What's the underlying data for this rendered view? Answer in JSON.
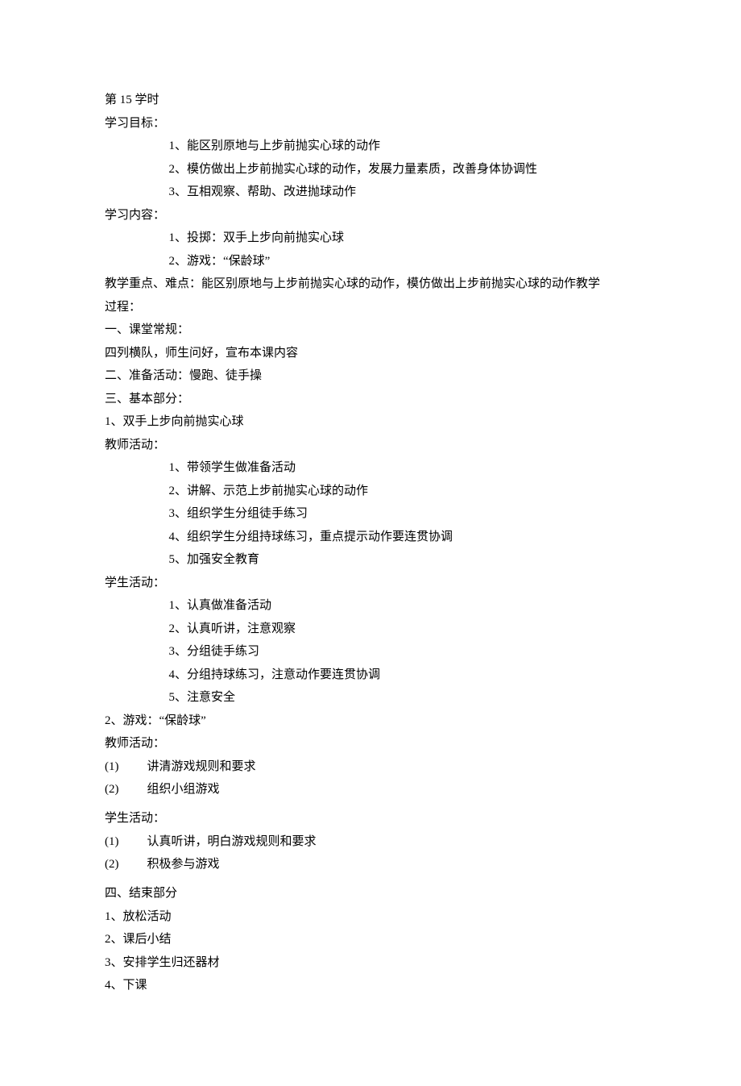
{
  "lesson_header": "第 15 学时",
  "labels": {
    "goals": "学习目标：",
    "content": "学习内容：",
    "keypoints_prefix": "教学重点、难点：",
    "process_suffix": "过程：",
    "section1": "一、课堂常规：",
    "section1_body": "四列横队，师生问好，宣布本课内容",
    "section2": "二、准备活动：慢跑、徒手操",
    "section3": "三、基本部分：",
    "part1": "1、双手上步向前抛实心球",
    "teacher_act": "教师活动：",
    "student_act": "学生活动：",
    "part2": "2、游戏：“保龄球”",
    "section4": "四、结束部分"
  },
  "goals": [
    "1、能区别原地与上步前抛实心球的动作",
    "2、模仿做出上步前抛实心球的动作，发展力量素质，改善身体协调性",
    "3、互相观察、帮助、改进抛球动作"
  ],
  "content_items": [
    "1、投掷：双手上步向前抛实心球",
    "2、游戏：“保龄球”"
  ],
  "keypoints_body": "能区别原地与上步前抛实心球的动作，模仿做出上步前抛实心球的动作教学",
  "teacher1": [
    "1、带领学生做准备活动",
    "2、讲解、示范上步前抛实心球的动作",
    "3、组织学生分组徒手练习",
    "4、组织学生分组持球练习，重点提示动作要连贯协调",
    "5、加强安全教育"
  ],
  "student1": [
    "1、认真做准备活动",
    "2、认真听讲，注意观察",
    "3、分组徒手练习",
    "4、分组持球练习，注意动作要连贯协调",
    "5、注意安全"
  ],
  "teacher2": [
    {
      "num": "(1)",
      "text": "讲清游戏规则和要求"
    },
    {
      "num": "(2)",
      "text": "组织小组游戏"
    }
  ],
  "student2": [
    {
      "num": "(1)",
      "text": "认真听讲，明白游戏规则和要求"
    },
    {
      "num": "(2)",
      "text": "积极参与游戏"
    }
  ],
  "ending": [
    "1、放松活动",
    "2、课后小结",
    "3、安排学生归还器材",
    "4、下课"
  ]
}
